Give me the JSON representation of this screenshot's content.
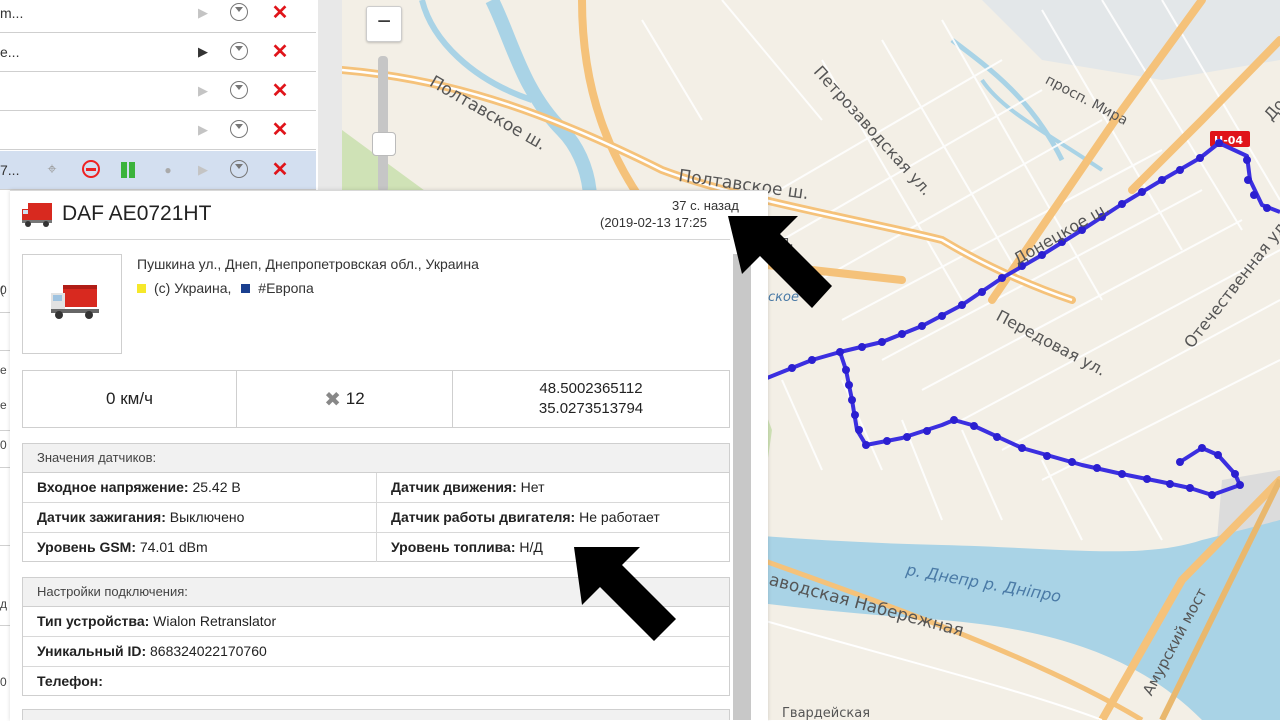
{
  "unit_list": {
    "rows": [
      {
        "name": "m...",
        "play_active": false
      },
      {
        "name": "e...",
        "play_active": true
      },
      {
        "name": "",
        "play_active": false
      },
      {
        "name": "",
        "play_active": false
      },
      {
        "name": "7...",
        "play_active": false,
        "selected": true
      }
    ],
    "left_fragments": [
      "0",
      "(",
      "е",
      "0",
      "д",
      "0",
      "е"
    ]
  },
  "map": {
    "zoom_out_label": "−",
    "labels": {
      "poltavske_sh_1": "Полтавское ш.",
      "poltavske_sh_2": "Полтавское ш.",
      "petrozavodskaya": "Петрозаводская ул.",
      "mira": "просп. Мира",
      "donetskoe": "Донецкое ш.",
      "do": "До",
      "otechestvennaya": "Отечественная ул.",
      "peredovaya": "Передовая ул.",
      "dnepr": "р. Днепр р. Дніпро",
      "naberezhnaya": "аводская Набережная",
      "amursky": "Амурский мост",
      "road_badge": "H-04",
      "ul_fragment": "ул.",
      "skovoe": "ское",
      "bottom_fragment": "Гвардейская"
    },
    "colors": {
      "track": "#3b2fe0",
      "major_road": "#f5c27a",
      "water": "#a9d3e6",
      "park": "#c9deb0"
    }
  },
  "card": {
    "title": "DAF AE0721HT",
    "ago": "37 с. назад",
    "timestamp": "(2019-02-13 17:25",
    "address": "Пушкина ул., Днеп, Днепропетровская обл., Украина",
    "region_ukraine": "(с) Украина,",
    "region_europe": "#Европа",
    "speed": "0 км/ч",
    "satellites": "12",
    "lat": "48.5002365112",
    "lon": "35.0273513794",
    "sensors": {
      "title": "Значения датчиков:",
      "rows": [
        [
          {
            "label": "Входное напряжение:",
            "value": " 25.42 В"
          },
          {
            "label": "Датчик движения:",
            "value": " Нет"
          }
        ],
        [
          {
            "label": "Датчик зажигания:",
            "value": " Выключено"
          },
          {
            "label": "Датчик работы двигателя:",
            "value": " Не работает"
          }
        ],
        [
          {
            "label": "Уровень GSM:",
            "value": " 74.01 dBm"
          },
          {
            "label": "Уровень топлива:",
            "value": " Н/Д"
          }
        ]
      ]
    },
    "connection": {
      "title": "Настройки подключения:",
      "rows": [
        {
          "label": "Тип устройства:",
          "value": " Wialon Retranslator"
        },
        {
          "label": "Уникальный ID:",
          "value": " 868324022170760"
        },
        {
          "label": "Телефон:",
          "value": ""
        }
      ]
    },
    "colors": {
      "region_ukraine": "#f6e82a",
      "region_europe": "#1a3f8f"
    }
  }
}
